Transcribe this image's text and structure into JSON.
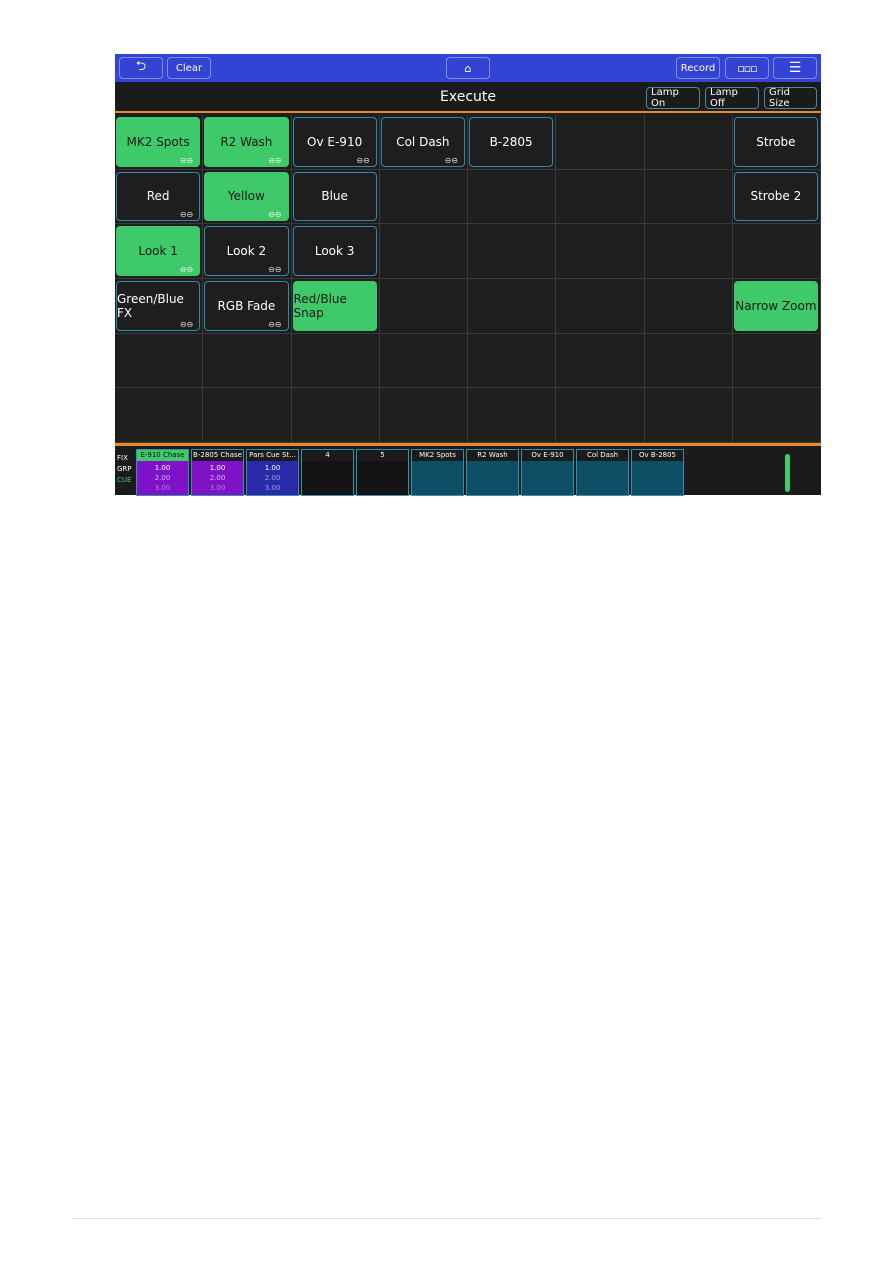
{
  "topbar": {
    "back_icon": "undo-arrow-icon",
    "clear": "Clear",
    "home_icon": "home-icon",
    "record": "Record",
    "grid_icon": "grid-icon",
    "menu_icon": "hamburger-menu-icon"
  },
  "titlebar": {
    "title": "Execute",
    "lamp_on": "Lamp On",
    "lamp_off": "Lamp Off",
    "grid_size": "Grid Size"
  },
  "colors": {
    "topbar": "#3343d4",
    "active": "#3ec96a",
    "accent": "#e98a2a",
    "border": "#2e8ca8"
  },
  "grid": {
    "columns": 8,
    "rows": 6,
    "cells": [
      {
        "r": 0,
        "c": 0,
        "label": "MK2 Spots",
        "on": true,
        "link": true
      },
      {
        "r": 0,
        "c": 1,
        "label": "R2 Wash",
        "on": true,
        "link": true
      },
      {
        "r": 0,
        "c": 2,
        "label": "Ov E-910",
        "on": false,
        "link": true
      },
      {
        "r": 0,
        "c": 3,
        "label": "Col Dash",
        "on": false,
        "link": true
      },
      {
        "r": 0,
        "c": 4,
        "label": "B-2805",
        "on": false,
        "link": false
      },
      {
        "r": 0,
        "c": 7,
        "label": "Strobe",
        "on": false,
        "link": false
      },
      {
        "r": 1,
        "c": 0,
        "label": "Red",
        "on": false,
        "link": true
      },
      {
        "r": 1,
        "c": 1,
        "label": "Yellow",
        "on": true,
        "link": true
      },
      {
        "r": 1,
        "c": 2,
        "label": "Blue",
        "on": false,
        "link": false
      },
      {
        "r": 1,
        "c": 7,
        "label": "Strobe 2",
        "on": false,
        "link": false
      },
      {
        "r": 2,
        "c": 0,
        "label": "Look 1",
        "on": true,
        "link": true
      },
      {
        "r": 2,
        "c": 1,
        "label": "Look 2",
        "on": false,
        "link": true
      },
      {
        "r": 2,
        "c": 2,
        "label": "Look 3",
        "on": false,
        "link": false
      },
      {
        "r": 3,
        "c": 0,
        "label": "Green/Blue FX",
        "on": false,
        "link": true
      },
      {
        "r": 3,
        "c": 1,
        "label": "RGB Fade",
        "on": false,
        "link": true
      },
      {
        "r": 3,
        "c": 2,
        "label": "Red/Blue Snap",
        "on": true,
        "link": false
      },
      {
        "r": 3,
        "c": 7,
        "label": "Narrow Zoom",
        "on": true,
        "link": false
      }
    ]
  },
  "bottom": {
    "labels": [
      "FIX",
      "GRP",
      "CUE"
    ],
    "playbacks": [
      {
        "name": "E-910 Chase",
        "cues": [
          "1.00",
          "2.00",
          "3.00"
        ],
        "color": "#7d12c8",
        "head": "#3ec96a"
      },
      {
        "name": "B-2805 Chase",
        "cues": [
          "1.00",
          "2.00",
          "3.00"
        ],
        "color": "#7d12c8"
      },
      {
        "name": "Pars Cue St...",
        "cues": [
          "1.00",
          "2.00",
          "3.00"
        ],
        "color": "#2a2aa8"
      },
      {
        "name": "4",
        "cues": [],
        "color": "#141414"
      },
      {
        "name": "5",
        "cues": [],
        "color": "#141414"
      },
      {
        "name": "MK2 Spots",
        "cues": [],
        "color": "#0f4f66"
      },
      {
        "name": "R2 Wash",
        "cues": [],
        "color": "#0f4f66"
      },
      {
        "name": "Ov E-910",
        "cues": [],
        "color": "#0f4f66"
      },
      {
        "name": "Col Dash",
        "cues": [],
        "color": "#0f4f66"
      },
      {
        "name": "Ov B-2805",
        "cues": [],
        "color": "#0f4f66"
      }
    ]
  }
}
